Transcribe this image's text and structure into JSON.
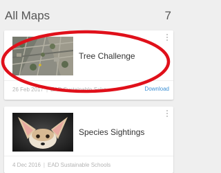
{
  "header": {
    "title": "All Maps",
    "count": "7"
  },
  "maps": [
    {
      "title": "Tree Challenge",
      "date": "26 Feb 2017",
      "org": "EAD Sustainable Scho...",
      "action": "Download",
      "thumbnail_icon": "aerial-map-thumbnail"
    },
    {
      "title": "Species Sightings",
      "date": "4 Dec 2016",
      "org": "EAD Sustainable Schools",
      "thumbnail_icon": "fennec-fox-thumbnail"
    }
  ],
  "colors": {
    "highlight": "#e0101a",
    "link": "#3b8fd4",
    "background": "#efefef"
  }
}
